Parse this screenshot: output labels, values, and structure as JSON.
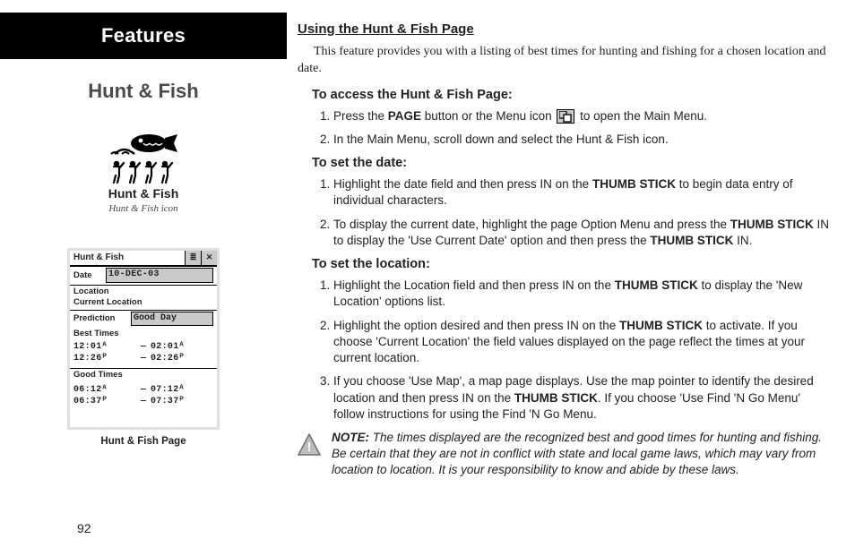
{
  "page_number": "92",
  "left": {
    "features_label": "Features",
    "section_title": "Hunt & Fish",
    "icon_label": "Hunt & Fish",
    "icon_caption": "Hunt & Fish  icon",
    "screen_caption": "Hunt & Fish Page",
    "screen": {
      "title": "Hunt & Fish",
      "menu_glyph": "≣",
      "close_glyph": "✕",
      "date_label": "Date",
      "date_value": "10-DEC-03",
      "location_label": "Location",
      "location_value": "Current Location",
      "prediction_label": "Prediction",
      "prediction_value": "Good Day",
      "best_label": "Best Times",
      "best_rows": [
        {
          "a": "12:01ᴬ",
          "b": "02:01ᴬ"
        },
        {
          "a": "12:26ᴾ",
          "b": "02:26ᴾ"
        }
      ],
      "good_label": "Good Times",
      "good_rows": [
        {
          "a": "06:12ᴬ",
          "b": "07:12ᴬ"
        },
        {
          "a": "06:37ᴾ",
          "b": "07:37ᴾ"
        }
      ]
    }
  },
  "right": {
    "heading": "Using the Hunt & Fish Page",
    "intro": "This feature provides you with a listing of best times for hunting and fishing for a chosen location and date.",
    "access": {
      "title": "To access the Hunt & Fish Page:",
      "s1a": "Press the ",
      "s1b": "PAGE",
      "s1c": " button or the Menu icon ",
      "s1d": " to open the Main Menu.",
      "s2": "In the Main Menu, scroll down and select the Hunt & Fish icon."
    },
    "date": {
      "title": "To set the date:",
      "s1a": "Highlight the date field and then press IN on the ",
      "s1b": "THUMB STICK",
      "s1c": " to begin data entry of individual characters.",
      "s2a": "To display the current date, highlight the page Option Menu and press the ",
      "s2b": "THUMB STICK",
      "s2c": " IN to display the 'Use Current Date' option and then press the ",
      "s2d": "THUMB STICK",
      "s2e": " IN."
    },
    "loc": {
      "title": "To set the location:",
      "s1a": "Highlight the Location field and then press IN on the ",
      "s1b": "THUMB STICK",
      "s1c": " to display the 'New Location' options list.",
      "s2a": "Highlight the option desired and then press IN on the ",
      "s2b": "THUMB STICK",
      "s2c": " to activate.  If you choose 'Current Location' the field values displayed on the page reflect the times at your current location.",
      "s3a": "If you choose 'Use Map', a map page displays.  Use the map pointer to identify the desired location and then press IN on the ",
      "s3b": "THUMB STICK",
      "s3c": ".  If you choose 'Use Find 'N Go Menu' follow instructions for using the Find 'N Go Menu."
    },
    "note": {
      "label": "NOTE:",
      "text": " The times displayed are the recognized best and good times for hunting and fishing.  Be certain that they are not in conflict with state and local game laws, which may vary from location to location. It is your responsibility to know and abide by these laws."
    }
  }
}
